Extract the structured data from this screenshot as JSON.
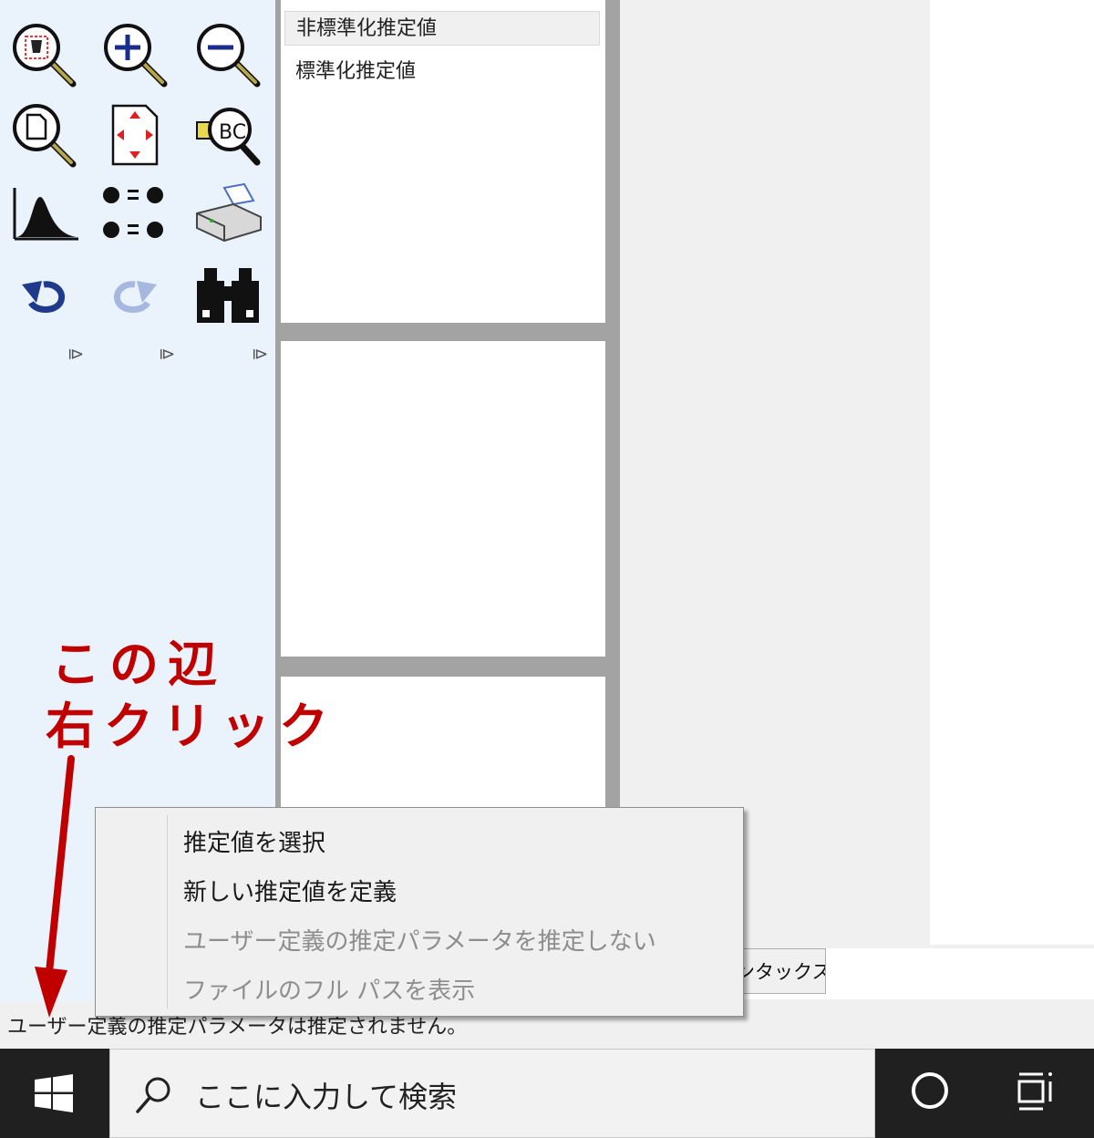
{
  "estimates_list": {
    "items": [
      "非標準化推定値",
      "標準化推定値"
    ],
    "selected_index": 0
  },
  "toolbar": {
    "icons": [
      "zoom-select-icon",
      "zoom-in-icon",
      "zoom-out-icon",
      "zoom-page-icon",
      "fit-to-page-icon",
      "loupe-icon",
      "histogram-icon",
      "degrees-of-freedom-icon",
      "print-icon",
      "undo-icon",
      "redo-icon",
      "binoculars-icon"
    ],
    "more_glyph": "⧐"
  },
  "syntax_tab": {
    "label": "ンタックス"
  },
  "status_bar": {
    "text": "ユーザー定義の推定パラメータは推定されません。"
  },
  "context_menu": {
    "items": [
      {
        "label": "推定値を選択",
        "enabled": true
      },
      {
        "label": "新しい推定値を定義",
        "enabled": true
      },
      {
        "label": "ユーザー定義の推定パラメータを推定しない",
        "enabled": false
      },
      {
        "label": "ファイルのフル パスを表示",
        "enabled": false
      }
    ]
  },
  "taskbar": {
    "search_placeholder": "ここに入力して検索"
  },
  "annotation": {
    "line1": "この辺",
    "line2": "右クリック",
    "color": "#c00000"
  }
}
